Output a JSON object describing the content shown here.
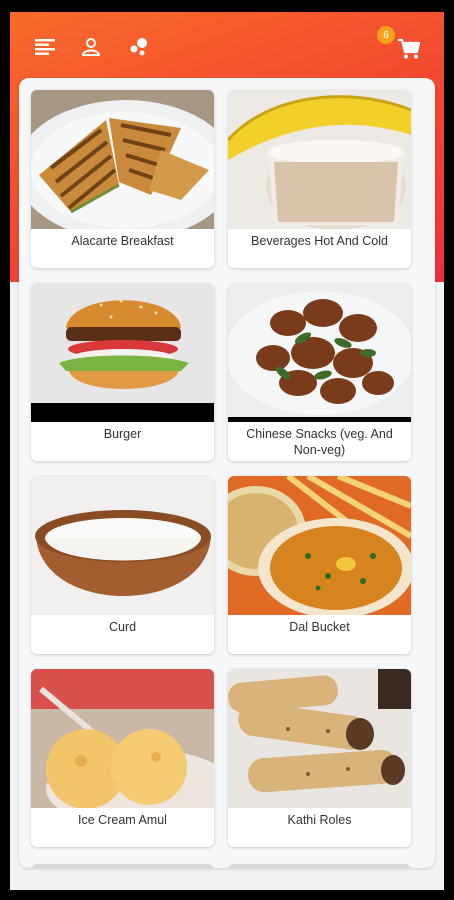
{
  "cart": {
    "count": "6"
  },
  "header": {
    "icons": [
      "menu-icon",
      "profile-icon",
      "categories-icon",
      "cart-icon"
    ]
  },
  "categories": [
    {
      "label": "Alacarte Breakfast",
      "image": "sandwich"
    },
    {
      "label": "Beverages Hot And Cold",
      "image": "banana-shake"
    },
    {
      "label": "Burger",
      "image": "burger"
    },
    {
      "label": "Chinese Snacks (veg. And Non-veg)",
      "image": "chilli-chicken"
    },
    {
      "label": "Curd",
      "image": "curd-bowl"
    },
    {
      "label": "Dal Bucket",
      "image": "dal"
    },
    {
      "label": "Ice Cream Amul",
      "image": "ice-cream"
    },
    {
      "label": "Kathi Roles",
      "image": "kathi-rolls"
    }
  ],
  "colors": {
    "header_start": "#f96a2a",
    "header_end": "#ee2f3b",
    "badge": "#f7a21b"
  }
}
